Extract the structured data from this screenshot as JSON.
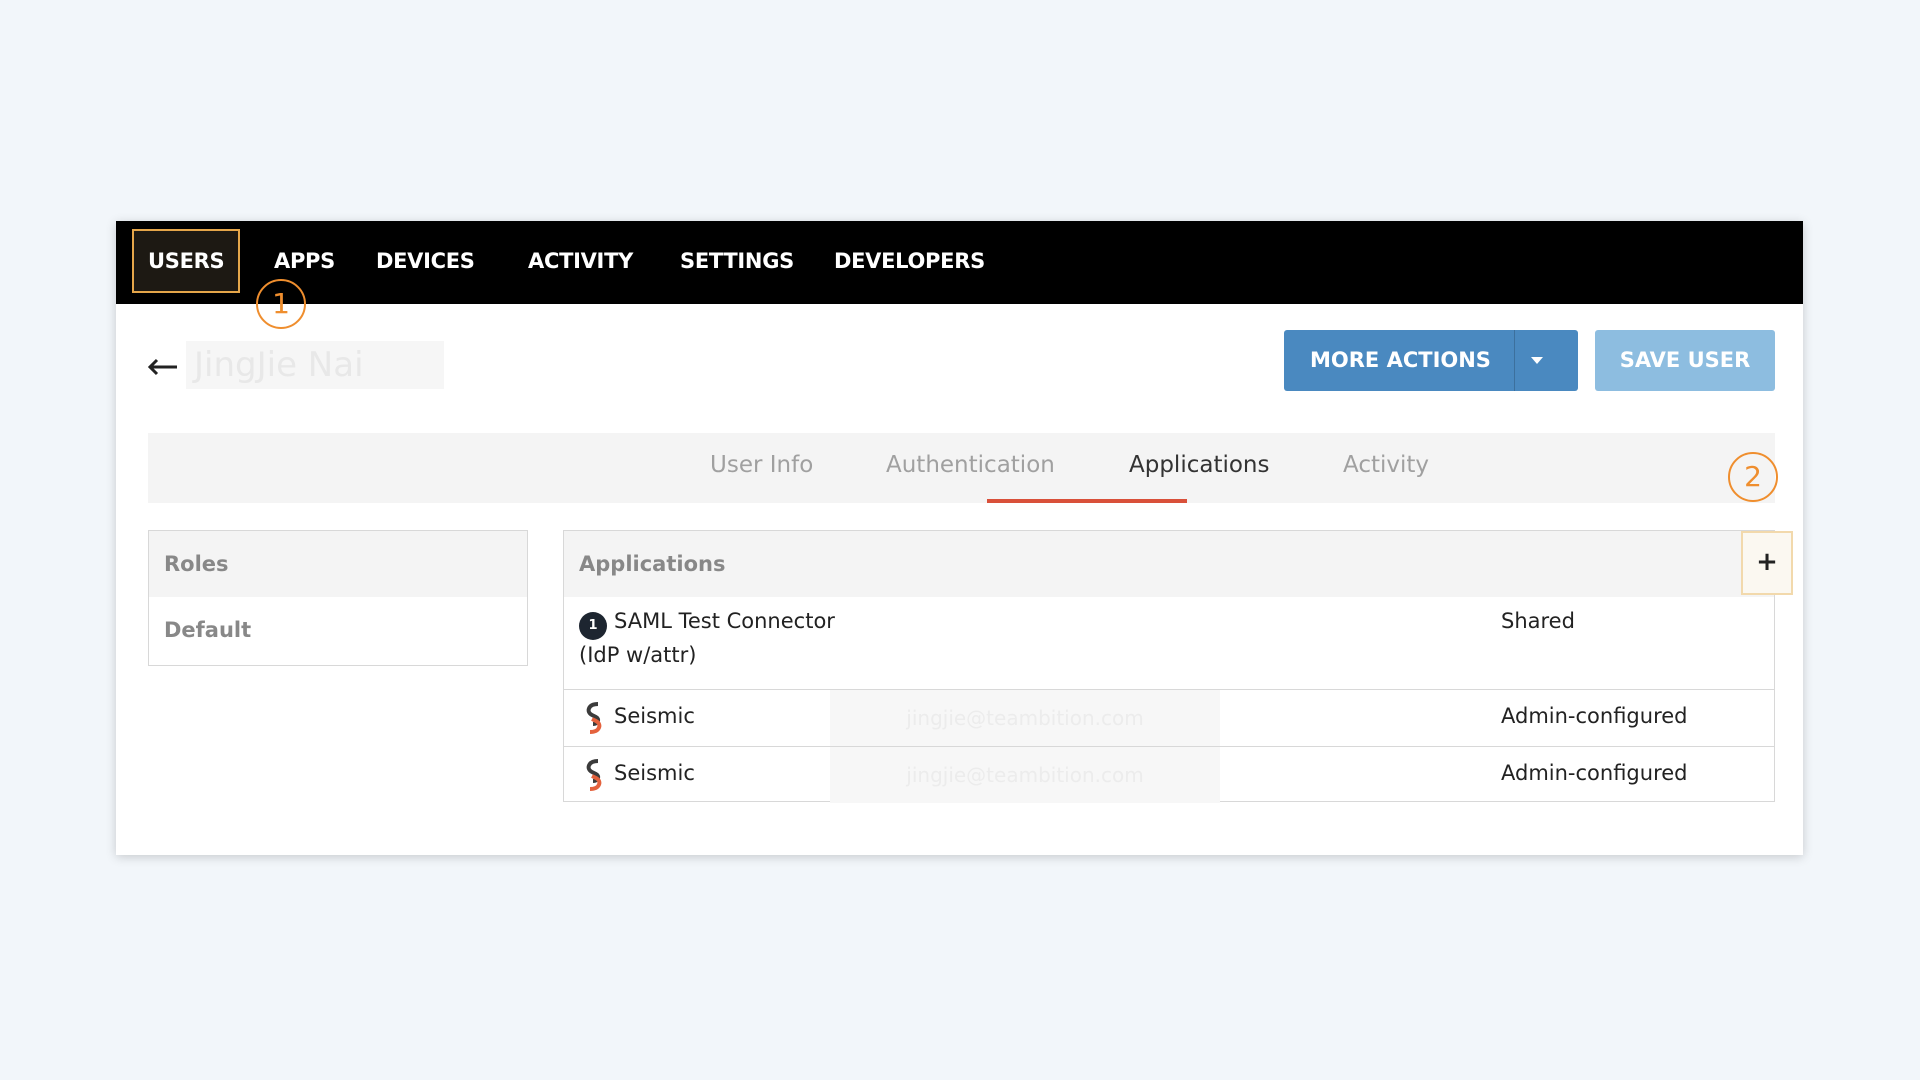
{
  "nav": {
    "items": [
      "USERS",
      "APPS",
      "DEVICES",
      "ACTIVITY",
      "SETTINGS",
      "DEVELOPERS"
    ],
    "active": "USERS"
  },
  "annotations": {
    "one": "1",
    "two": "2"
  },
  "header": {
    "back_icon": "arrow-left-icon",
    "user_name": "JingJie Nai",
    "more_actions_label": "MORE ACTIONS",
    "save_user_label": "SAVE USER",
    "more_actions_color": "#4a89c0",
    "save_user_color": "#8dbde0"
  },
  "tabs": {
    "items": [
      "User Info",
      "Authentication",
      "Applications",
      "Activity"
    ],
    "active": "Applications",
    "underline_color": "#d9503a"
  },
  "roles": {
    "header": "Roles",
    "rows": [
      "Default"
    ]
  },
  "applications": {
    "header": "Applications",
    "add_label": "+",
    "rows": [
      {
        "icon": "onelogin-icon",
        "icon_text": "1",
        "name_line1": "SAML Test Connector",
        "name_line2": "(IdP w/attr)",
        "login": "",
        "access": "Shared"
      },
      {
        "icon": "seismic-icon",
        "name_line1": "Seismic",
        "login": "jingjie@teambition.com",
        "access": "Admin-configured"
      },
      {
        "icon": "seismic-icon",
        "name_line1": "Seismic",
        "login": "jingjie@teambition.com",
        "access": "Admin-configured"
      }
    ]
  }
}
